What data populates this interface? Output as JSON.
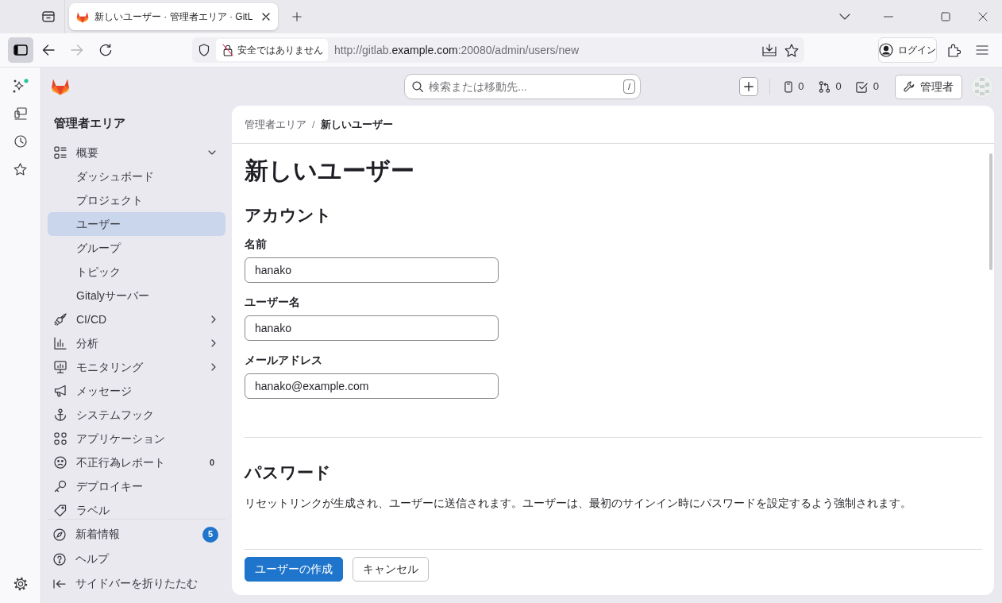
{
  "browser": {
    "tabs": [
      {
        "title": "新しいユーザー · 管理者エリア · GitL",
        "selected": true
      }
    ],
    "security_label": "安全ではありません",
    "url": {
      "prefix": "http://gitlab.",
      "domain": "example.com",
      "suffix": ":20080/admin/users/new"
    },
    "login_label": "ログイン"
  },
  "header": {
    "search": {
      "placeholder": "検索または移動先...",
      "shortcut": "/"
    },
    "counters": [
      {
        "count": "0"
      },
      {
        "count": "0"
      },
      {
        "count": "0"
      }
    ],
    "admin_button": "管理者"
  },
  "sidebar": {
    "title": "管理者エリア",
    "items": [
      {
        "label": "概要",
        "kind": "group",
        "expanded": true,
        "selected": false,
        "children": [
          {
            "label": "ダッシュボード",
            "selected": false
          },
          {
            "label": "プロジェクト",
            "selected": false
          },
          {
            "label": "ユーザー",
            "selected": true
          },
          {
            "label": "グループ",
            "selected": false
          },
          {
            "label": "トピック",
            "selected": false
          },
          {
            "label": "Gitalyサーバー",
            "selected": false
          }
        ]
      },
      {
        "label": "CI/CD",
        "kind": "group",
        "expanded": false,
        "selected": false
      },
      {
        "label": "分析",
        "kind": "group",
        "expanded": false,
        "selected": false
      },
      {
        "label": "モニタリング",
        "kind": "group",
        "expanded": false,
        "selected": false
      },
      {
        "label": "メッセージ",
        "kind": "link",
        "selected": false
      },
      {
        "label": "システムフック",
        "kind": "link",
        "selected": false
      },
      {
        "label": "アプリケーション",
        "kind": "link",
        "selected": false
      },
      {
        "label": "不正行為レポート",
        "kind": "link",
        "selected": false,
        "count": "0"
      },
      {
        "label": "デプロイキー",
        "kind": "link",
        "selected": false
      },
      {
        "label": "ラベル",
        "kind": "link",
        "selected": false
      }
    ],
    "footer_items": [
      {
        "label": "新着情報",
        "badge": "5"
      },
      {
        "label": "ヘルプ"
      },
      {
        "label": "サイドバーを折りたたむ"
      }
    ]
  },
  "main": {
    "breadcrumb": {
      "separator": "/",
      "items": [
        {
          "label": "管理者エリア",
          "current": false
        },
        {
          "label": "新しいユーザー",
          "current": true
        }
      ]
    },
    "title": "新しいユーザー",
    "sections": [
      {
        "heading": "アカウント",
        "fields": [
          {
            "label": "名前",
            "value": "hanako"
          },
          {
            "label": "ユーザー名",
            "value": "hanako"
          },
          {
            "label": "メールアドレス",
            "value": "hanako@example.com"
          }
        ]
      },
      {
        "heading": "パスワード",
        "description": "リセットリンクが生成され、ユーザーに送信されます。ユーザーは、最初のサインイン時にパスワードを設定するよう強制されます。"
      }
    ],
    "buttons": [
      {
        "label": "ユーザーの作成",
        "kind": "primary"
      },
      {
        "label": "キャンセル",
        "kind": "secondary"
      }
    ]
  }
}
